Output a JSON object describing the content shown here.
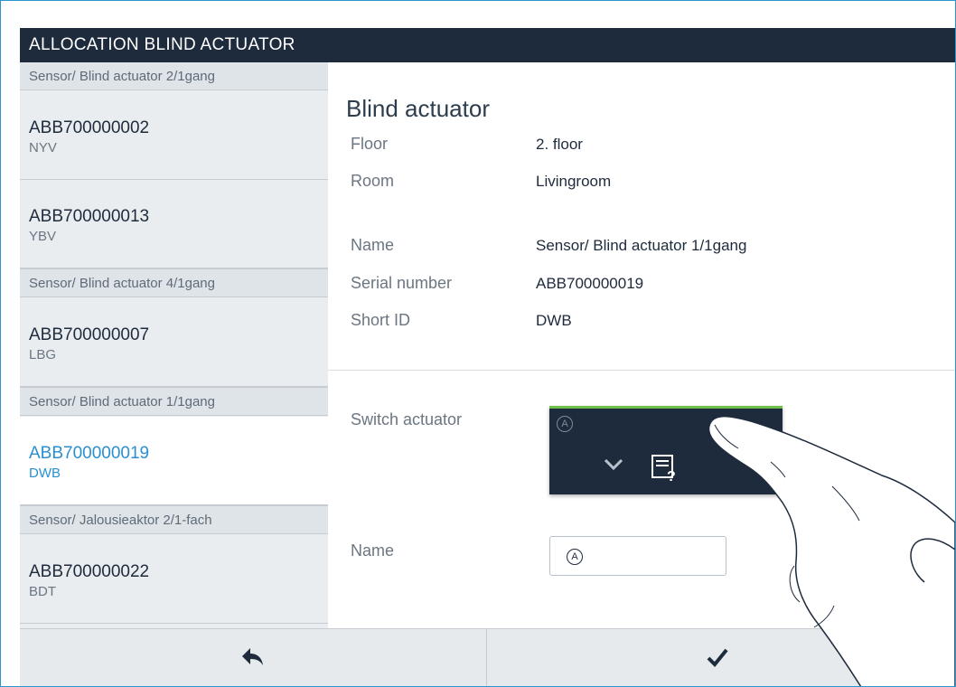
{
  "header": {
    "title": "ALLOCATION BLIND ACTUATOR"
  },
  "sidebar": {
    "groups": [
      {
        "header": "Sensor/ Blind actuator 2/1gang"
      },
      {
        "header": "Sensor/ Blind actuator 4/1gang"
      },
      {
        "header": "Sensor/ Blind actuator 1/1gang"
      },
      {
        "header": "Sensor/ Jalousieaktor 2/1-fach"
      }
    ],
    "items": [
      {
        "serial": "ABB700000002",
        "short_id": "NYV"
      },
      {
        "serial": "ABB700000013",
        "short_id": "YBV"
      },
      {
        "serial": "ABB700000007",
        "short_id": "LBG"
      },
      {
        "serial": "ABB700000019",
        "short_id": "DWB",
        "selected": true
      },
      {
        "serial": "ABB700000022",
        "short_id": "BDT"
      }
    ]
  },
  "detail": {
    "title": "Blind actuator",
    "properties": [
      {
        "label": "Floor",
        "value": "2. floor"
      },
      {
        "label": "Room",
        "value": "Livingroom"
      },
      {
        "label": "Name",
        "value": "Sensor/ Blind actuator 1/1gang"
      },
      {
        "label": "Serial number",
        "value": "ABB700000019"
      },
      {
        "label": "Short ID",
        "value": "DWB"
      }
    ],
    "switch_actuator_label": "Switch actuator",
    "name_label": "Name",
    "tile_icons": {
      "letter": "A",
      "chevron": "chevron-down-icon",
      "help": "device-help-icon"
    },
    "name_input": {
      "icon_letter": "A",
      "value": ""
    }
  },
  "footer": {
    "back_icon": "back-arrow-icon",
    "confirm_icon": "checkmark-icon"
  },
  "colors": {
    "title_bar": "#1e2b3c",
    "accent_blue": "#2a8fd0",
    "tile_active_line": "#6fbf4a",
    "frame_border": "#2b95cf"
  }
}
